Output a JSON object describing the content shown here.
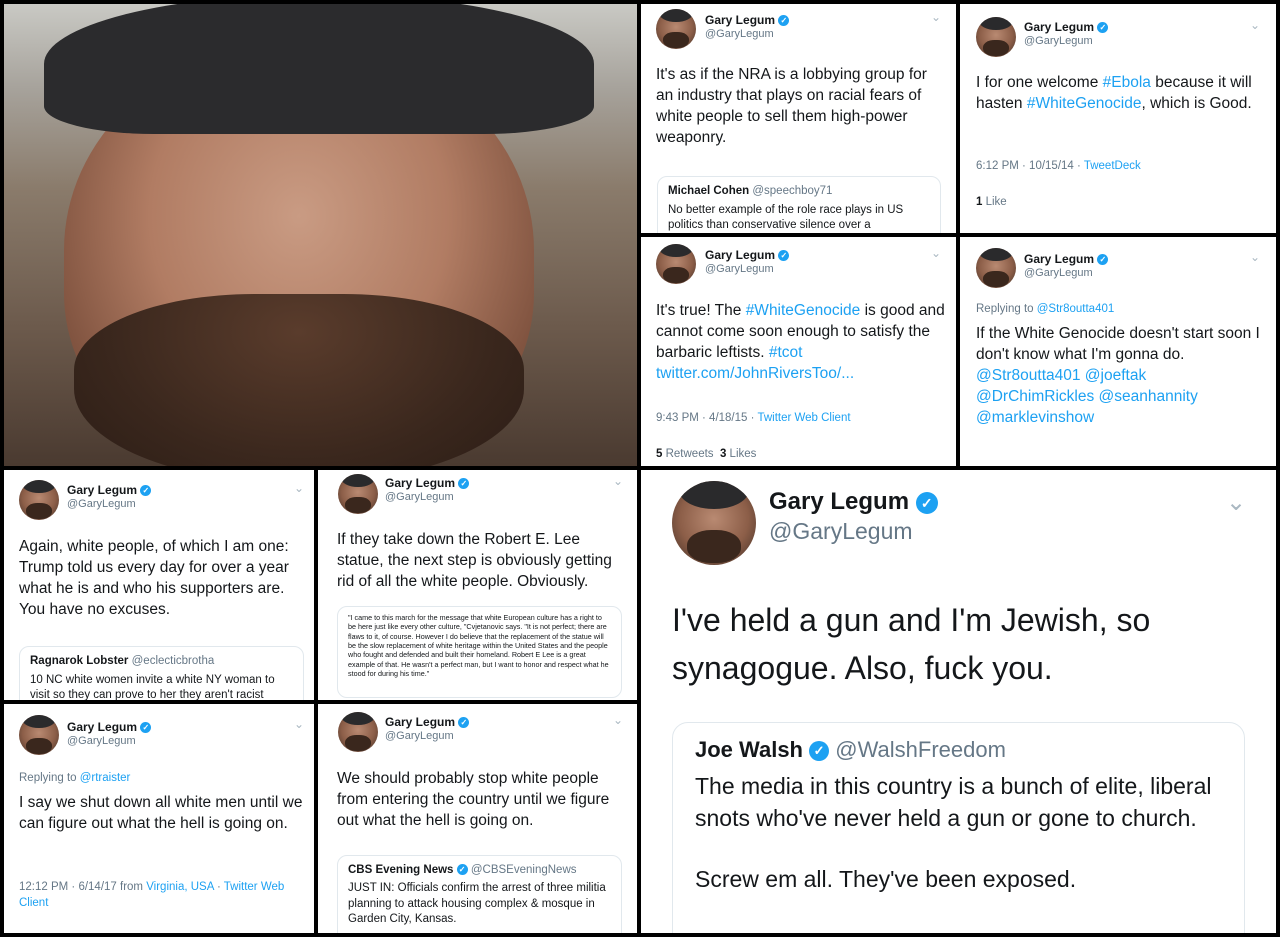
{
  "tiles": {
    "nra": {
      "name": "Gary Legum",
      "handle": "@GaryLegum",
      "text": "It's as if the NRA is a lobbying group for an industry that plays on racial fears of white people to sell them high-power weaponry.",
      "quote_name": "Michael Cohen",
      "quote_handle": "@speechboy71",
      "quote_text": "No better example of the role race plays in US politics than conservative silence over a"
    },
    "ebola": {
      "name": "Gary Legum",
      "handle": "@GaryLegum",
      "text_pre": "I for one welcome ",
      "tag1": "#Ebola",
      "text_mid": " because it will hasten ",
      "tag2": "#WhiteGenocide",
      "text_post": ", which is Good.",
      "time": "6:12 PM · 10/15/14 · ",
      "client": "TweetDeck",
      "likes_count": "1",
      "likes_label": "Like"
    },
    "true": {
      "name": "Gary Legum",
      "handle": "@GaryLegum",
      "text_pre": "It's true! The ",
      "tag1": "#WhiteGenocide",
      "text_mid": " is good and cannot come soon enough to satisfy the barbaric leftists. ",
      "tag2": "#tcot",
      "link": "twitter.com/JohnRiversToo/...",
      "time": "9:43 PM · 4/18/15 · ",
      "client": "Twitter Web Client",
      "rt_count": "5",
      "rt_label": "Retweets",
      "likes_count": "3",
      "likes_label": "Likes"
    },
    "soon": {
      "name": "Gary Legum",
      "handle": "@GaryLegum",
      "reply_label": "Replying to ",
      "reply_to": "@Str8outta401",
      "text": "If the White Genocide doesn't start soon I don't know what I'm gonna do.",
      "mentions": "@Str8outta401 @joeftak @DrChimRickles @seanhannity @marklevinshow"
    },
    "excuses": {
      "name": "Gary Legum",
      "handle": "@GaryLegum",
      "text": "Again, white people, of which I am one: Trump told us every day for over a year what he is and who his supporters are. You have no excuses.",
      "quote_name": "Ragnarok Lobster",
      "quote_handle": "@eclecticbrotha",
      "quote_text": "10 NC white women invite a white NY woman to visit so they can prove to her they aren't racist"
    },
    "lee": {
      "name": "Gary Legum",
      "handle": "@GaryLegum",
      "text": "If they take down the Robert E. Lee statue, the next step is obviously getting rid of all the white people. Obviously.",
      "quote_text": "\"I came to this march for the message that white European culture has a right to be here just like every other culture, \"Cvjetanovic says. \"It is not perfect; there are flaws to it, of course. However I do believe that the replacement of the statue will be the slow replacement of white heritage within the United States and the people who fought and defended and built their homeland. Robert E Lee is a great example of that. He wasn't a perfect man, but I want to honor and respect what he stood for during his time.\""
    },
    "shutdown": {
      "name": "Gary Legum",
      "handle": "@GaryLegum",
      "reply_label": "Replying to ",
      "reply_to": "@rtraister",
      "text": "I say we shut down all white men until we can figure out what the hell is going on.",
      "time": "12:12 PM · 6/14/17 from ",
      "location": "Virginia, USA",
      "sep": " · ",
      "client": "Twitter Web Client"
    },
    "stop": {
      "name": "Gary Legum",
      "handle": "@GaryLegum",
      "text": "We should probably stop white people from entering the country until we figure out what the hell is going on.",
      "quote_name": "CBS Evening News",
      "quote_handle": "@CBSEveningNews",
      "quote_text": "JUST IN: Officials confirm the arrest of three militia planning to attack housing complex & mosque in Garden City, Kansas."
    },
    "gun": {
      "name": "Gary Legum",
      "handle": "@GaryLegum",
      "text": "I've held a gun and I'm Jewish, so synagogue. Also, fuck you.",
      "quote_name": "Joe Walsh",
      "quote_handle": "@WalshFreedom",
      "quote_text1": "The media in this country is a bunch of elite, liberal snots who've never held a gun or gone to church.",
      "quote_text2": "Screw em all. They've been exposed."
    }
  },
  "colors": {
    "accent": "#1da1f2",
    "muted": "#657786",
    "background": "#000000"
  },
  "icons": {
    "verified": "verified-badge-icon",
    "chevron": "chevron-down-icon"
  }
}
